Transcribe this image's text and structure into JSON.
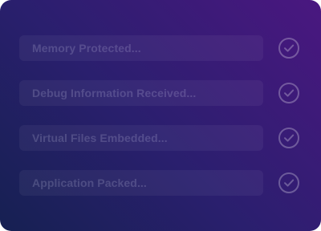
{
  "steps": [
    {
      "label": "Memory Protected...",
      "status_icon": "check-circle-icon"
    },
    {
      "label": "Debug Information Received...",
      "status_icon": "check-circle-icon"
    },
    {
      "label": "Virtual Files Embedded...",
      "status_icon": "check-circle-icon"
    },
    {
      "label": "Application Packed...",
      "status_icon": "check-circle-icon"
    }
  ],
  "colors": {
    "background_start": "#162052",
    "background_end": "#4a1780",
    "label": "#ebe8ff",
    "icon": "#ffffff"
  }
}
